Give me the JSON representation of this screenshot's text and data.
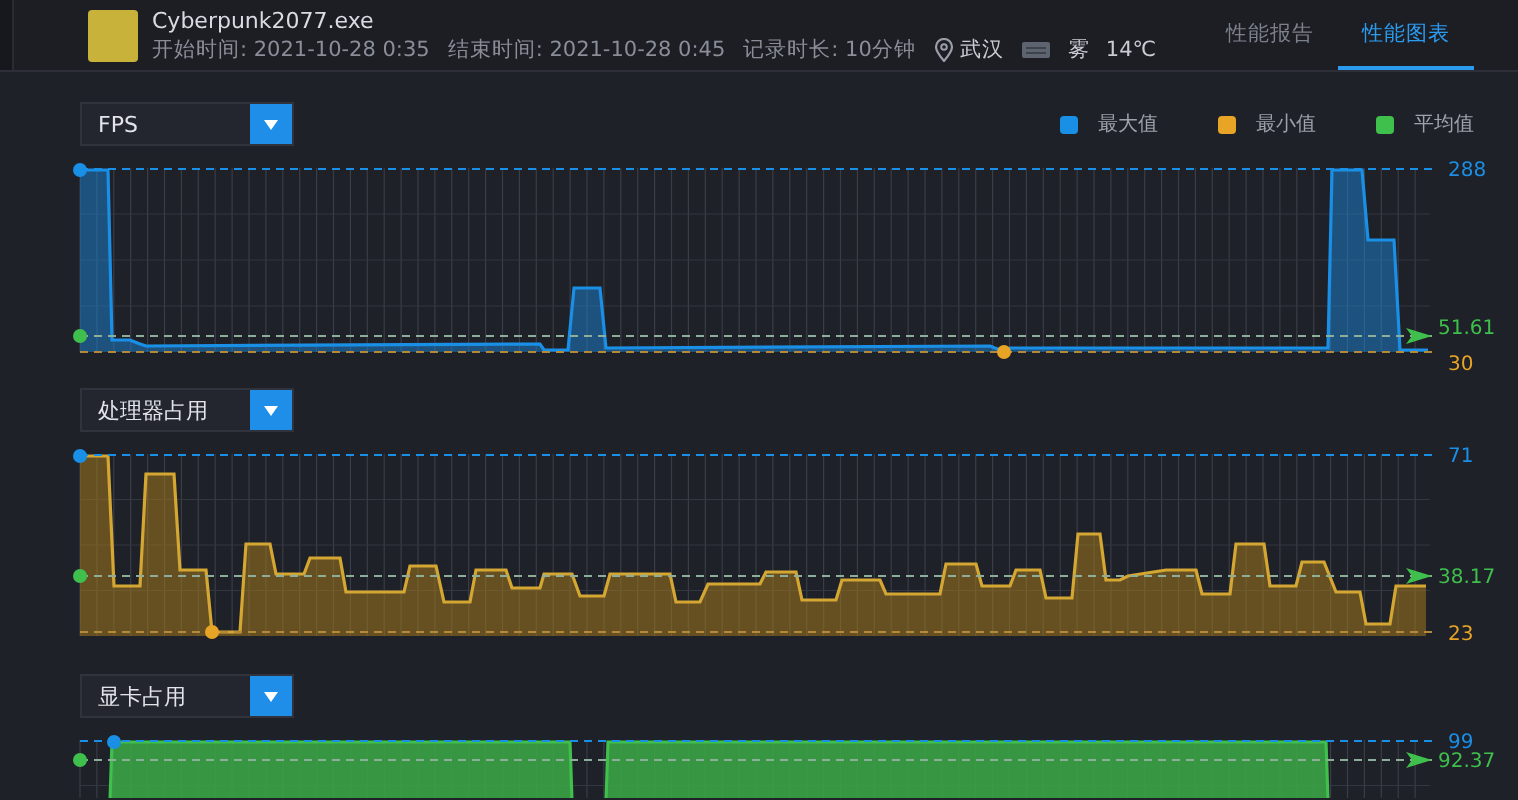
{
  "app": {
    "name": "Cyberpunk2077.exe",
    "start": "开始时间: 2021-10-28 0:35",
    "end": "结束时间: 2021-10-28 0:45",
    "duration": "记录时长: 10分钟",
    "location": "武汉",
    "weather": "雾",
    "temperature": "14℃"
  },
  "tabs": [
    {
      "label": "性能报告",
      "selected": false
    },
    {
      "label": "性能图表",
      "selected": true
    }
  ],
  "legend": [
    {
      "label": "最大值",
      "color": "#1a8fe6"
    },
    {
      "label": "最小值",
      "color": "#e8a424"
    },
    {
      "label": "平均值",
      "color": "#3fbf4c"
    }
  ],
  "panels": [
    {
      "kind": "fps",
      "metric": "FPS",
      "max": "288",
      "avg": "51.61",
      "min": "30"
    },
    {
      "kind": "cpu",
      "metric": "处理器占用",
      "max": "71",
      "avg": "38.17",
      "min": "23"
    },
    {
      "kind": "gpu",
      "metric": "显卡占用",
      "max": "99",
      "avg": "92.37"
    }
  ]
}
